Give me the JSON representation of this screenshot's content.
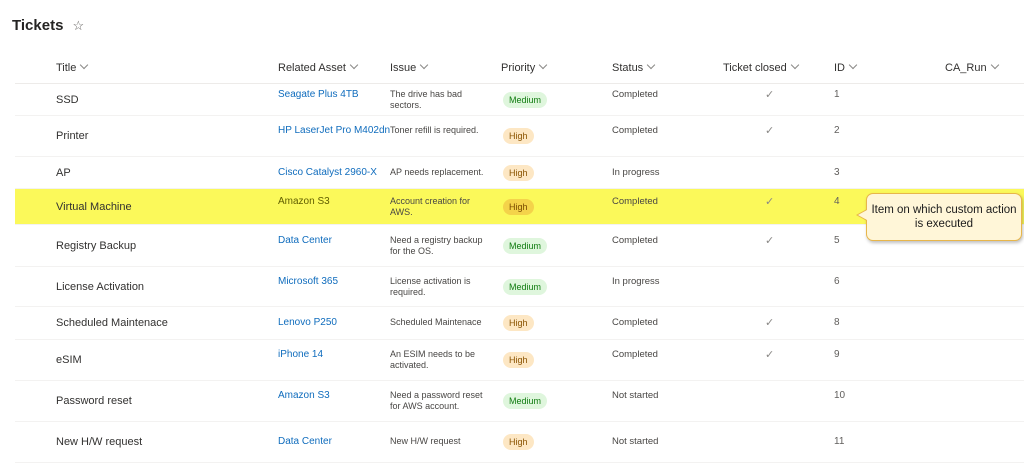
{
  "page": {
    "title": "Tickets"
  },
  "columns": {
    "title": "Title",
    "related_asset": "Related Asset",
    "issue": "Issue",
    "priority": "Priority",
    "status": "Status",
    "ticket_closed": "Ticket closed",
    "id": "ID",
    "ca_run": "CA_Run"
  },
  "rows": [
    {
      "title": "SSD",
      "asset": "Seagate Plus 4TB",
      "issue": "The drive has bad sectors.",
      "priority": "Medium",
      "status": "Completed",
      "closed": "✓",
      "id": "1"
    },
    {
      "title": "Printer",
      "asset": "HP LaserJet Pro M402dn",
      "issue": "Toner refill is required.",
      "priority": "High",
      "status": "Completed",
      "closed": "✓",
      "id": "2"
    },
    {
      "title": "AP",
      "asset": "Cisco Catalyst 2960-X",
      "issue": "AP needs replacement.",
      "priority": "High",
      "status": "In progress",
      "closed": "",
      "id": "3"
    },
    {
      "title": "Virtual Machine",
      "asset": "Amazon S3",
      "issue": "Account creation for AWS.",
      "priority": "High",
      "status": "Completed",
      "closed": "✓",
      "id": "4",
      "highlighted": true
    },
    {
      "title": "Registry Backup",
      "asset": "Data Center",
      "issue": "Need a registry backup for the OS.",
      "priority": "Medium",
      "status": "Completed",
      "closed": "✓",
      "id": "5"
    },
    {
      "title": "License Activation",
      "asset": "Microsoft 365",
      "issue": "License activation is required.",
      "priority": "Medium",
      "status": "In progress",
      "closed": "",
      "id": "6"
    },
    {
      "title": "Scheduled Maintenace",
      "asset": "Lenovo P250",
      "issue": "Scheduled Maintenace",
      "priority": "High",
      "status": "Completed",
      "closed": "✓",
      "id": "8"
    },
    {
      "title": "eSIM",
      "asset": "iPhone 14",
      "issue": "An ESIM needs to be activated.",
      "priority": "High",
      "status": "Completed",
      "closed": "✓",
      "id": "9"
    },
    {
      "title": "Password reset",
      "asset": "Amazon S3",
      "issue": "Need a password reset for AWS account.",
      "priority": "Medium",
      "status": "Not started",
      "closed": "",
      "id": "10"
    },
    {
      "title": "New H/W request",
      "asset": "Data Center",
      "issue": "New H/W request",
      "priority": "High",
      "status": "Not started",
      "closed": "",
      "id": "11"
    }
  ],
  "callout": {
    "text": "Item on which custom action is executed"
  },
  "icons": {
    "favorite": "star-icon",
    "sort": "chevron-down-icon",
    "check": "checkmark-icon"
  },
  "colors": {
    "highlight": "#fbf95a",
    "link": "#0f6cbd",
    "medium_pill": "#dff6dd",
    "high_pill": "#fde7c4",
    "callout_bg": "#fff6d8"
  }
}
